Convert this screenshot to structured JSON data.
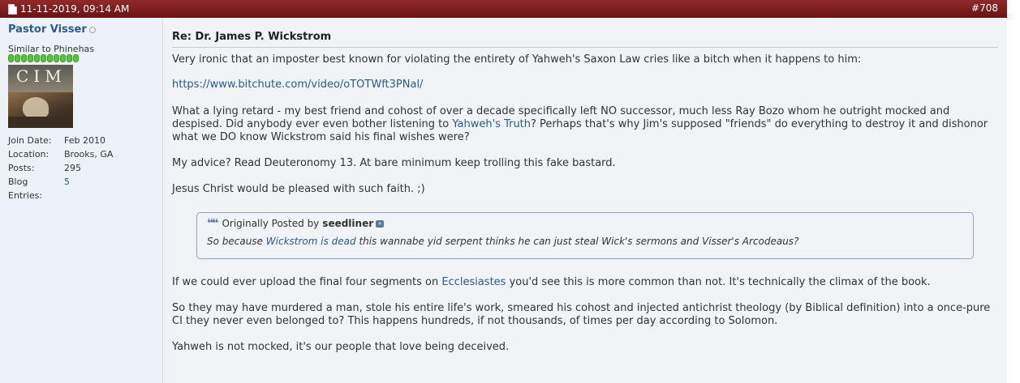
{
  "post": {
    "date": "11-11-2019, 09:14 AM",
    "number": "#708",
    "title": "Re: Dr. James P. Wickstrom"
  },
  "user": {
    "name": "Pastor Visser",
    "title": "Similar to Phinehas",
    "avatar_text": "CIM",
    "stats": [
      {
        "label": "Join Date:",
        "value": "Feb 2010"
      },
      {
        "label": "Location:",
        "value": "Brooks, GA"
      },
      {
        "label": "Posts:",
        "value": "295"
      },
      {
        "label": "Blog Entries:",
        "value": "5"
      }
    ]
  },
  "body": {
    "p1": "Very ironic that an imposter best known for violating the entirety of Yahweh's Saxon Law cries like a bitch when it happens to him:",
    "link_url": "https://www.bitchute.com/video/oTOTWft3PNal/",
    "p3_a": "What a lying retard - my best friend and cohost of over a decade specifically left NO successor, much less Ray Bozo whom he outright mocked and despised. Did anybody ever even bother listening to ",
    "p3_link": "Yahweh's Truth",
    "p3_b": "? Perhaps that's why Jim's supposed \"friends\" do everything to destroy it and dishonor what we DO know Wickstrom said his final wishes were?",
    "p4": "My advice? Read Deuteronomy 13. At bare minimum keep trolling this fake bastard.",
    "p5": "Jesus Christ would be pleased with such faith. ;)",
    "p6_a": "If we could ever upload the final four segments on ",
    "p6_link": "Ecclesiastes",
    "p6_b": " you'd see this is more common than not. It's technically the climax of the book.",
    "p7": "So they may have murdered a man, stole his entire life's work, smeared his cohost and injected antichrist theology (by Biblical definition) into a once-pure CI they never even belonged to? This happens hundreds, if not thousands, of times per day according to Solomon.",
    "p8": "Yahweh is not mocked, it's our people that love being deceived."
  },
  "quote": {
    "prefix": "Originally Posted by",
    "author": "seedliner",
    "body_a": "So because ",
    "body_link": "Wickstrom is dead",
    "body_b": " this wannabe yid serpent thinks he can just steal Wick's sermons and Visser's Arcodeaus?"
  },
  "colors": {
    "header": "#7e1c1c",
    "link": "#2c5a8c",
    "sidebar": "#edf1f8",
    "reputation": "#57c43b"
  }
}
